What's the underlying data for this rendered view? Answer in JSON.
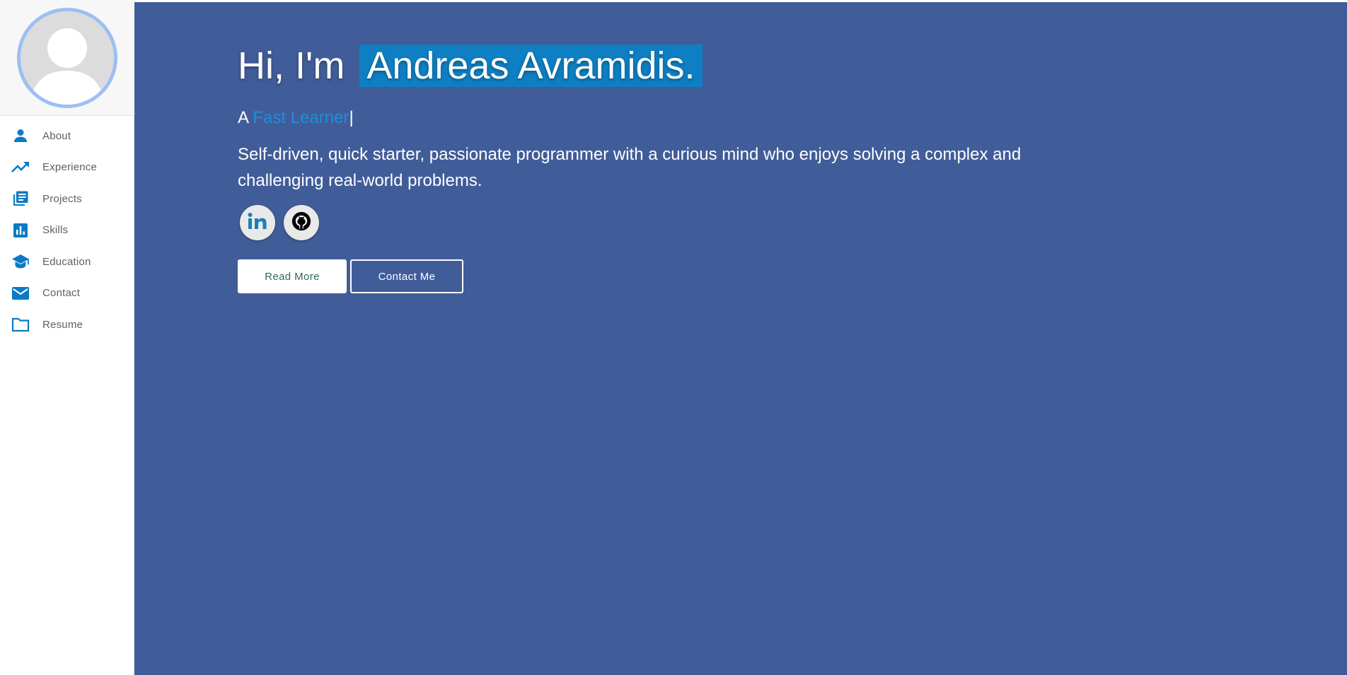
{
  "sidebar": {
    "avatar_alt": "",
    "items": [
      {
        "label": "About",
        "icon": "person-icon"
      },
      {
        "label": "Experience",
        "icon": "trending-up-icon"
      },
      {
        "label": "Projects",
        "icon": "library-books-icon"
      },
      {
        "label": "Skills",
        "icon": "bar-chart-icon"
      },
      {
        "label": "Education",
        "icon": "school-icon"
      },
      {
        "label": "Contact",
        "icon": "mail-icon"
      },
      {
        "label": "Resume",
        "icon": "folder-icon"
      }
    ]
  },
  "hero": {
    "greeting_prefix": "Hi, I'm",
    "name": "Andreas Avramidis.",
    "tagline_prefix": "A",
    "tagline_typed": "Fast Learner",
    "tagline_cursor": "|",
    "bio": "Self-driven, quick starter, passionate programmer with a curious mind who enjoys solving a complex and challenging real-world problems.",
    "socials": [
      {
        "name": "linkedin-icon"
      },
      {
        "name": "github-icon"
      }
    ],
    "read_more_label": "Read More",
    "contact_label": "Contact Me"
  },
  "colors": {
    "hero_background": "#415d99",
    "accent": "#0e7fc2",
    "sidebar_icon": "#0a7bc4",
    "avatar_ring": "#9dbff2"
  }
}
